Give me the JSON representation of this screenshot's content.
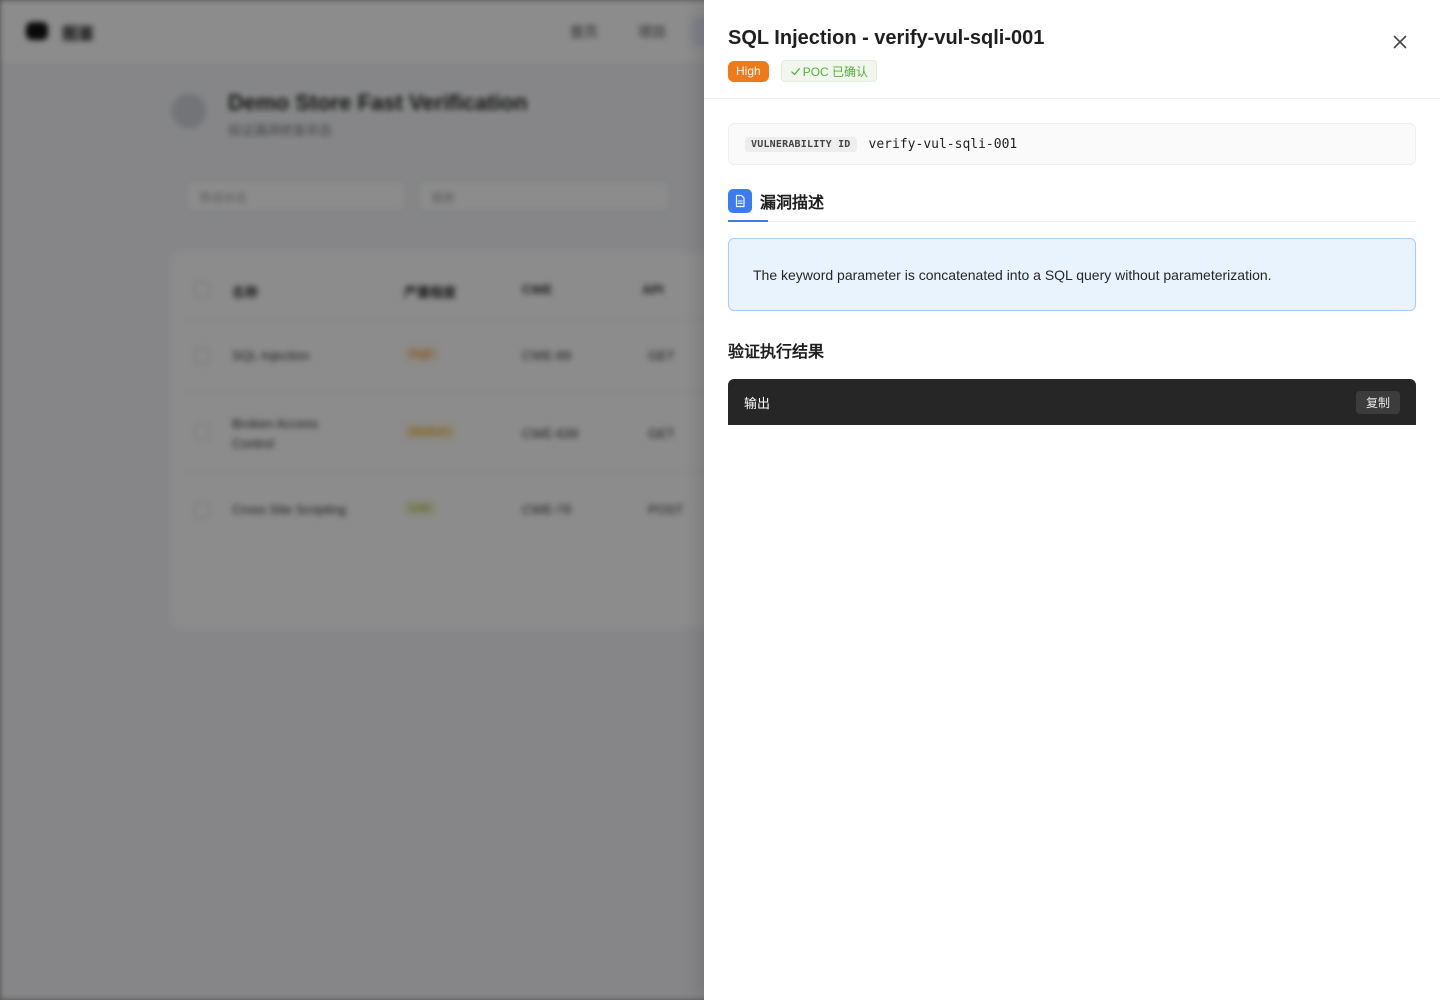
{
  "background_page": {
    "brand": "图鉴",
    "nav": [
      "首页",
      "项目"
    ],
    "title": "Demo Store Fast Verification",
    "subtitle": "验证漏洞修复状态",
    "filter_placeholder": "筛选状态",
    "search_placeholder": "搜索",
    "table": {
      "headers": [
        "名称",
        "严重程度",
        "CWE",
        "API"
      ],
      "rows": [
        {
          "name": "SQL Injection",
          "severity": "High",
          "cwe": "CWE-89",
          "api": "GET"
        },
        {
          "name": "Broken Access Control",
          "severity": "Medium",
          "cwe": "CWE-639",
          "api": "GET"
        },
        {
          "name": "Cross Site Scripting",
          "severity": "Low",
          "cwe": "CWE-79",
          "api": "POST"
        }
      ]
    }
  },
  "drawer": {
    "title": "SQL Injection - verify-vul-sqli-001",
    "severity_badge": "High",
    "poc_badge": "POC 已确认",
    "close_icon": "close-icon",
    "vulnerability_id_label": "VULNERABILITY ID",
    "vulnerability_id_value": "verify-vul-sqli-001",
    "description_tab_label": "漏洞描述",
    "description_text": "The keyword parameter is concatenated into a SQL query without parameterization.",
    "result_heading": "验证执行结果",
    "output_label": "输出",
    "copy_button": "复制"
  },
  "colors": {
    "severity_high": "#f07a1a",
    "poc_confirmed_text": "#52b03a",
    "accent_blue": "#3b7cf0",
    "description_bg": "#e8f3fd",
    "output_bar_bg": "#262626"
  }
}
